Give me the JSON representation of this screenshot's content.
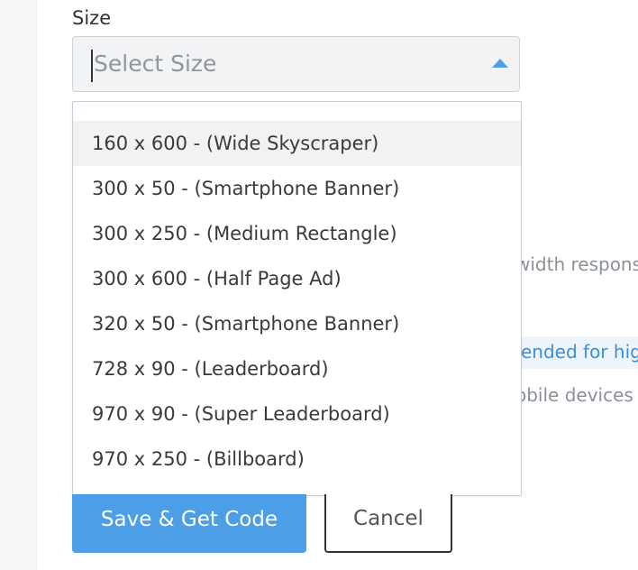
{
  "form": {
    "size_label": "Size",
    "select": {
      "placeholder": "Select Size",
      "options": [
        "160 x 600 - (Wide Skyscraper)",
        "300 x 50 - (Smartphone Banner)",
        "300 x 250 - (Medium Rectangle)",
        "300 x 600 - (Half Page Ad)",
        "320 x 50 - (Smartphone Banner)",
        "728 x 90 - (Leaderboard)",
        "970 x 90 - (Super Leaderboard)",
        "970 x 250 - (Billboard)"
      ],
      "highlighted_index": 0
    },
    "background_fragments": [
      "width respons",
      "ended for high",
      "obile devices"
    ],
    "buttons": {
      "save": "Save & Get Code",
      "cancel": "Cancel"
    }
  },
  "colors": {
    "accent": "#4c9fe6",
    "link": "#3b8fd6",
    "placeholder": "#8f96a0"
  },
  "icons": {
    "select_arrow": "caret-up-icon"
  }
}
